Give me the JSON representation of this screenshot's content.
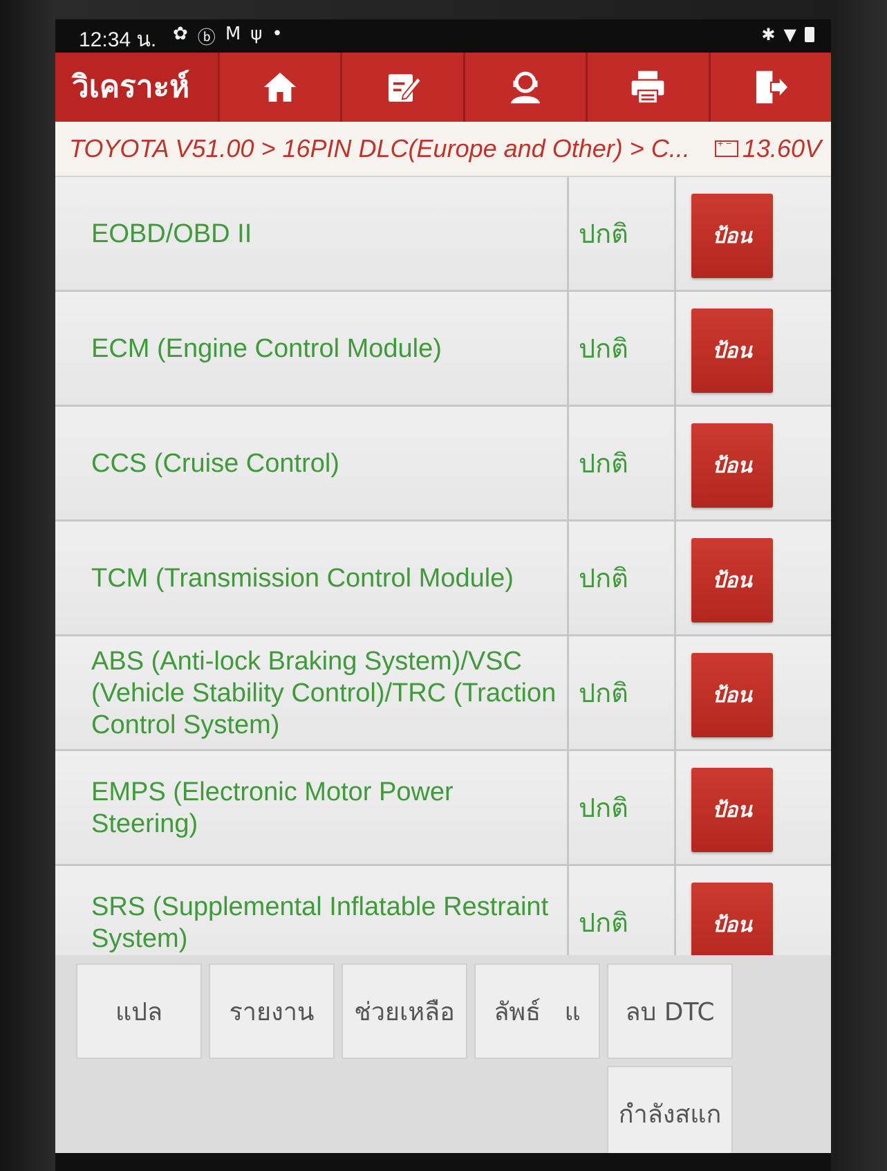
{
  "status_bar": {
    "time": "12:34 น.",
    "left_icons": [
      "gear-icon",
      "bluetooth-circle-icon",
      "gmail-icon",
      "usb-icon",
      "dot"
    ],
    "right_icons": [
      "bluetooth-icon",
      "wifi-icon",
      "battery-icon"
    ]
  },
  "header": {
    "title": "วิเคราะห์",
    "buttons": [
      "home-icon",
      "edit-icon",
      "support-agent-icon",
      "printer-icon",
      "exit-icon"
    ],
    "accent_color": "#b82523"
  },
  "breadcrumb": {
    "path": "TOYOTA V51.00 > 16PIN DLC(Europe and Other) > C...",
    "voltage": "13.60V"
  },
  "systems": [
    {
      "name": "EOBD/OBD II",
      "status": "ปกติ",
      "action": "ป้อน"
    },
    {
      "name": "ECM (Engine Control Module)",
      "status": "ปกติ",
      "action": "ป้อน"
    },
    {
      "name": "CCS (Cruise Control)",
      "status": "ปกติ",
      "action": "ป้อน"
    },
    {
      "name": "TCM (Transmission Control Module)",
      "status": "ปกติ",
      "action": "ป้อน"
    },
    {
      "name": "ABS (Anti-lock Braking System)/VSC (Vehicle Stability Control)/TRC (Traction Control System)",
      "status": "ปกติ",
      "action": "ป้อน"
    },
    {
      "name": "EMPS (Electronic Motor Power Steering)",
      "status": "ปกติ",
      "action": "ป้อน"
    },
    {
      "name": "SRS (Supplemental Inflatable Restraint System)",
      "status": "ปกติ",
      "action": "ป้อน"
    }
  ],
  "actions": {
    "translate": "แปล",
    "report": "รายงาน",
    "help": "ช่วยเหลือ",
    "results": "ลัพธ์   แ",
    "clear_dtc": "ลบ DTC",
    "scanning": "กำลังสแก"
  }
}
